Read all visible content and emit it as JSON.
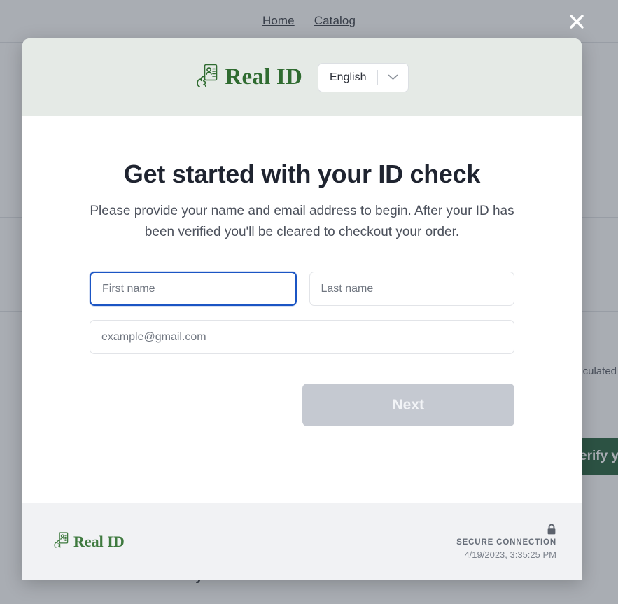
{
  "background": {
    "nav": [
      {
        "label": "Home",
        "name": "nav-link-home"
      },
      {
        "label": "Catalog",
        "name": "nav-link-catalog"
      }
    ],
    "shipping_note": "alculated",
    "verify_button": "erify y",
    "footer_headings": [
      "Talk about your business",
      "Newsletter"
    ]
  },
  "overlay": {
    "close_icon": "close-icon"
  },
  "modal": {
    "header": {
      "logo_icon": "hand-holding-id-card-icon",
      "brand_name": "Real ID",
      "language": {
        "selected": "English",
        "chevron_icon": "chevron-down-icon"
      }
    },
    "content": {
      "title": "Get started with your ID check",
      "subtitle": "Please provide your name and email address to begin. After your ID has been verified you'll be cleared to checkout your order.",
      "fields": {
        "first_name": {
          "placeholder": "First name",
          "value": ""
        },
        "last_name": {
          "placeholder": "Last name",
          "value": ""
        },
        "email": {
          "placeholder": "example@gmail.com",
          "value": ""
        }
      },
      "next_button": "Next"
    },
    "footer": {
      "logo_icon": "hand-holding-id-card-icon",
      "brand_name": "Real ID",
      "lock_icon": "lock-icon",
      "secure_label": "SECURE CONNECTION",
      "timestamp": "4/19/2023, 3:35:25 PM"
    }
  },
  "colors": {
    "brand_green": "#2f6b30",
    "header_bg": "#e5eae6",
    "focus_blue": "#1b55c4",
    "disabled_btn": "#c5c9d1",
    "verify_green": "#14532d"
  }
}
